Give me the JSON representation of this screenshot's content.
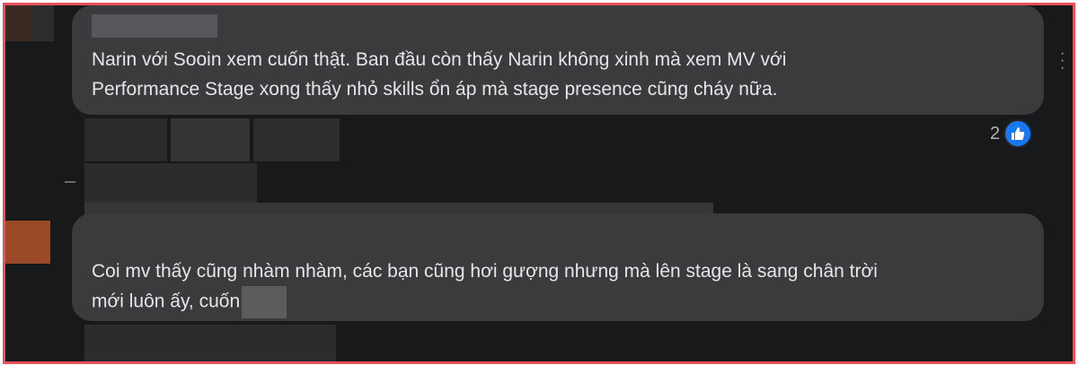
{
  "comments": [
    {
      "lines": [
        "Narin với Sooin xem cuốn thật. Ban đầu còn thấy Narin không xinh mà xem MV với",
        "Performance Stage xong thấy nhỏ skills ổn áp mà stage presence cũng cháy nữa."
      ],
      "reaction_count": "2",
      "reaction_icon": "like-icon"
    },
    {
      "lines": [
        "Coi mv thấy cũng nhàm nhàm, các bạn cũng hơi gượng nhưng mà lên stage là sang chân trời",
        "mới luôn ấy, cuốn"
      ]
    }
  ],
  "colors": {
    "background": "#18191a",
    "bubble": "#3a3b3c",
    "text": "#e4e6eb",
    "muted": "#b0b3b8",
    "like": "#1877f2",
    "frame_border": "#e8505b"
  },
  "icons": [
    "more-options-icon",
    "like-icon"
  ]
}
